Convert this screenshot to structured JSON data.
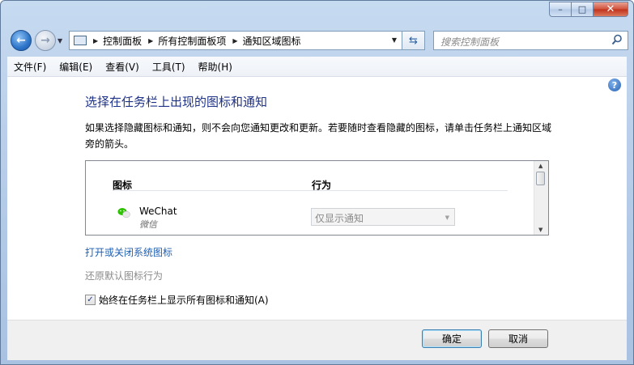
{
  "window": {
    "minimize_glyph": "–",
    "maximize_glyph": "□",
    "close_glyph": "✕"
  },
  "nav": {
    "back_glyph": "←",
    "forward_glyph": "→",
    "breadcrumb": [
      "控制面板",
      "所有控制面板项",
      "通知区域图标"
    ],
    "search_placeholder": "搜索控制面板"
  },
  "menu": [
    "文件(F)",
    "编辑(E)",
    "查看(V)",
    "工具(T)",
    "帮助(H)"
  ],
  "main": {
    "heading": "选择在任务栏上出现的图标和通知",
    "description": "如果选择隐藏图标和通知，则不会向您通知更改和更新。若要随时查看隐藏的图标，请单击任务栏上通知区域旁的箭头。",
    "columns": {
      "icon": "图标",
      "action": "行为"
    },
    "apps": [
      {
        "name": "WeChat",
        "subtitle": "微信",
        "behavior": "仅显示通知",
        "icon": "wechat-icon"
      }
    ],
    "link_system_icons": "打开或关闭系统图标",
    "link_restore": "还原默认图标行为",
    "checkbox_label": "始终在任务栏上显示所有图标和通知(A)",
    "checkbox_checked": true
  },
  "buttons": {
    "ok": "确定",
    "cancel": "取消"
  },
  "colors": {
    "heading": "#1e3287",
    "link": "#1f5fb3",
    "wechat": "#2dc100"
  }
}
